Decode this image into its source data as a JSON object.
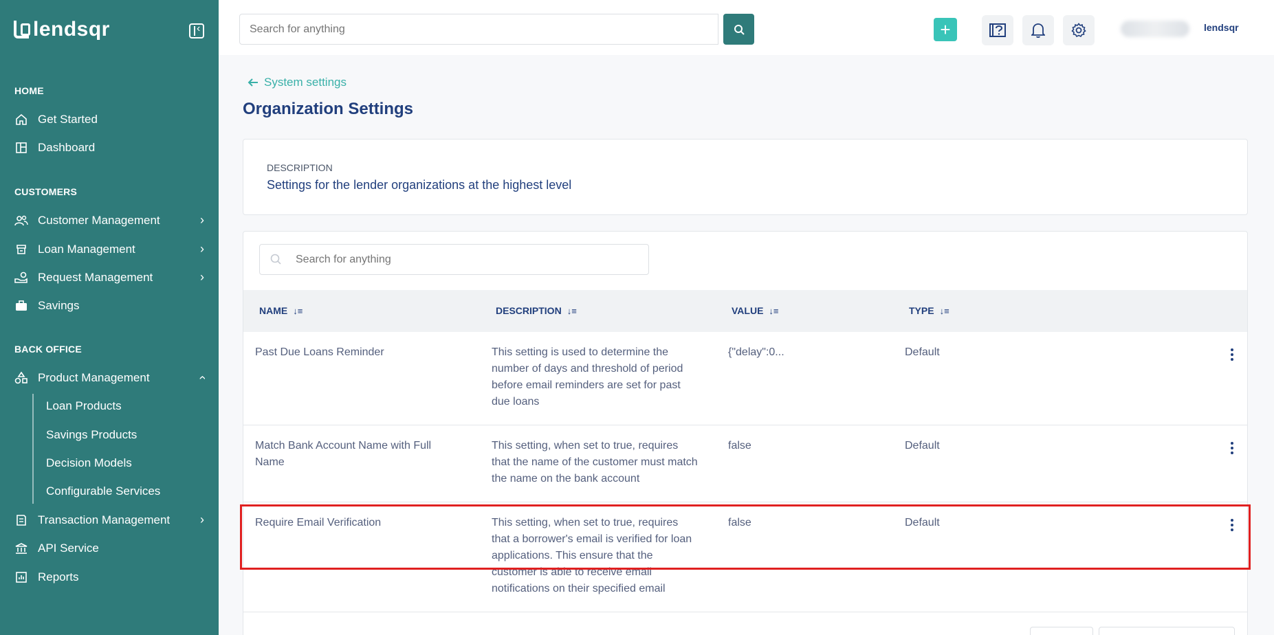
{
  "app": {
    "brand": "lendsqr",
    "brand_small": "lendsqr"
  },
  "topbar": {
    "search_placeholder": "Search for anything"
  },
  "sidebar": {
    "sections": [
      {
        "title": "HOME",
        "items": [
          {
            "label": "Get Started"
          },
          {
            "label": "Dashboard"
          }
        ]
      },
      {
        "title": "CUSTOMERS",
        "items": [
          {
            "label": "Customer Management"
          },
          {
            "label": "Loan Management"
          },
          {
            "label": "Request Management"
          },
          {
            "label": "Savings"
          }
        ]
      },
      {
        "title": "BACK OFFICE",
        "items": [
          {
            "label": "Product Management"
          },
          {
            "label": "Transaction Management"
          },
          {
            "label": "API Service"
          },
          {
            "label": "Reports"
          }
        ]
      }
    ],
    "sub_items": [
      {
        "label": "Loan Products"
      },
      {
        "label": "Savings Products"
      },
      {
        "label": "Decision Models"
      },
      {
        "label": "Configurable Services"
      }
    ]
  },
  "page": {
    "back_label": "System settings",
    "title": "Organization Settings",
    "description_label": "DESCRIPTION",
    "description": "Settings for the lender organizations at the highest level"
  },
  "table": {
    "search_placeholder": "Search for anything",
    "columns": [
      {
        "label": "NAME"
      },
      {
        "label": "DESCRIPTION"
      },
      {
        "label": "VALUE"
      },
      {
        "label": "TYPE"
      }
    ],
    "rows": [
      {
        "name": "Past Due Loans Reminder",
        "description": "This setting is used to determine the number of days and threshold of period before email reminders are set for past due loans",
        "value": "{\"delay\":0...",
        "type": "Default"
      },
      {
        "name": "Match Bank Account Name with Full Name",
        "description": "This setting, when set to true, requires that the name of the customer must match the name on the bank account",
        "value": "false",
        "type": "Default"
      },
      {
        "name": "Require Email Verification",
        "description": "This setting, when set to true, requires that a borrower's email is verified for loan applications. This ensure that the customer is able to receive email notifications on their specified email",
        "value": "false",
        "type": "Default"
      }
    ]
  },
  "colors": {
    "sidebar": "#2f7b7a",
    "accent": "#39c4b8",
    "text": "#213f7d",
    "highlight": "#e02020"
  }
}
